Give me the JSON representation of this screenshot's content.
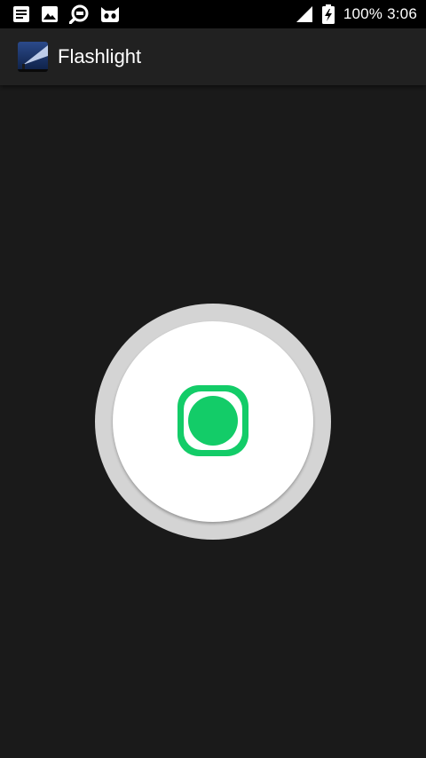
{
  "status_bar": {
    "left_icons": [
      "notes-icon",
      "image-icon",
      "search-icon",
      "cat-icon"
    ],
    "battery_percent": "100%",
    "time": "3:06"
  },
  "action_bar": {
    "title": "Flashlight",
    "logo_icon": "flashlight-beam-icon"
  },
  "flashlight": {
    "toggle_icon": "power-dot-icon",
    "accent_color": "#13cc68"
  }
}
